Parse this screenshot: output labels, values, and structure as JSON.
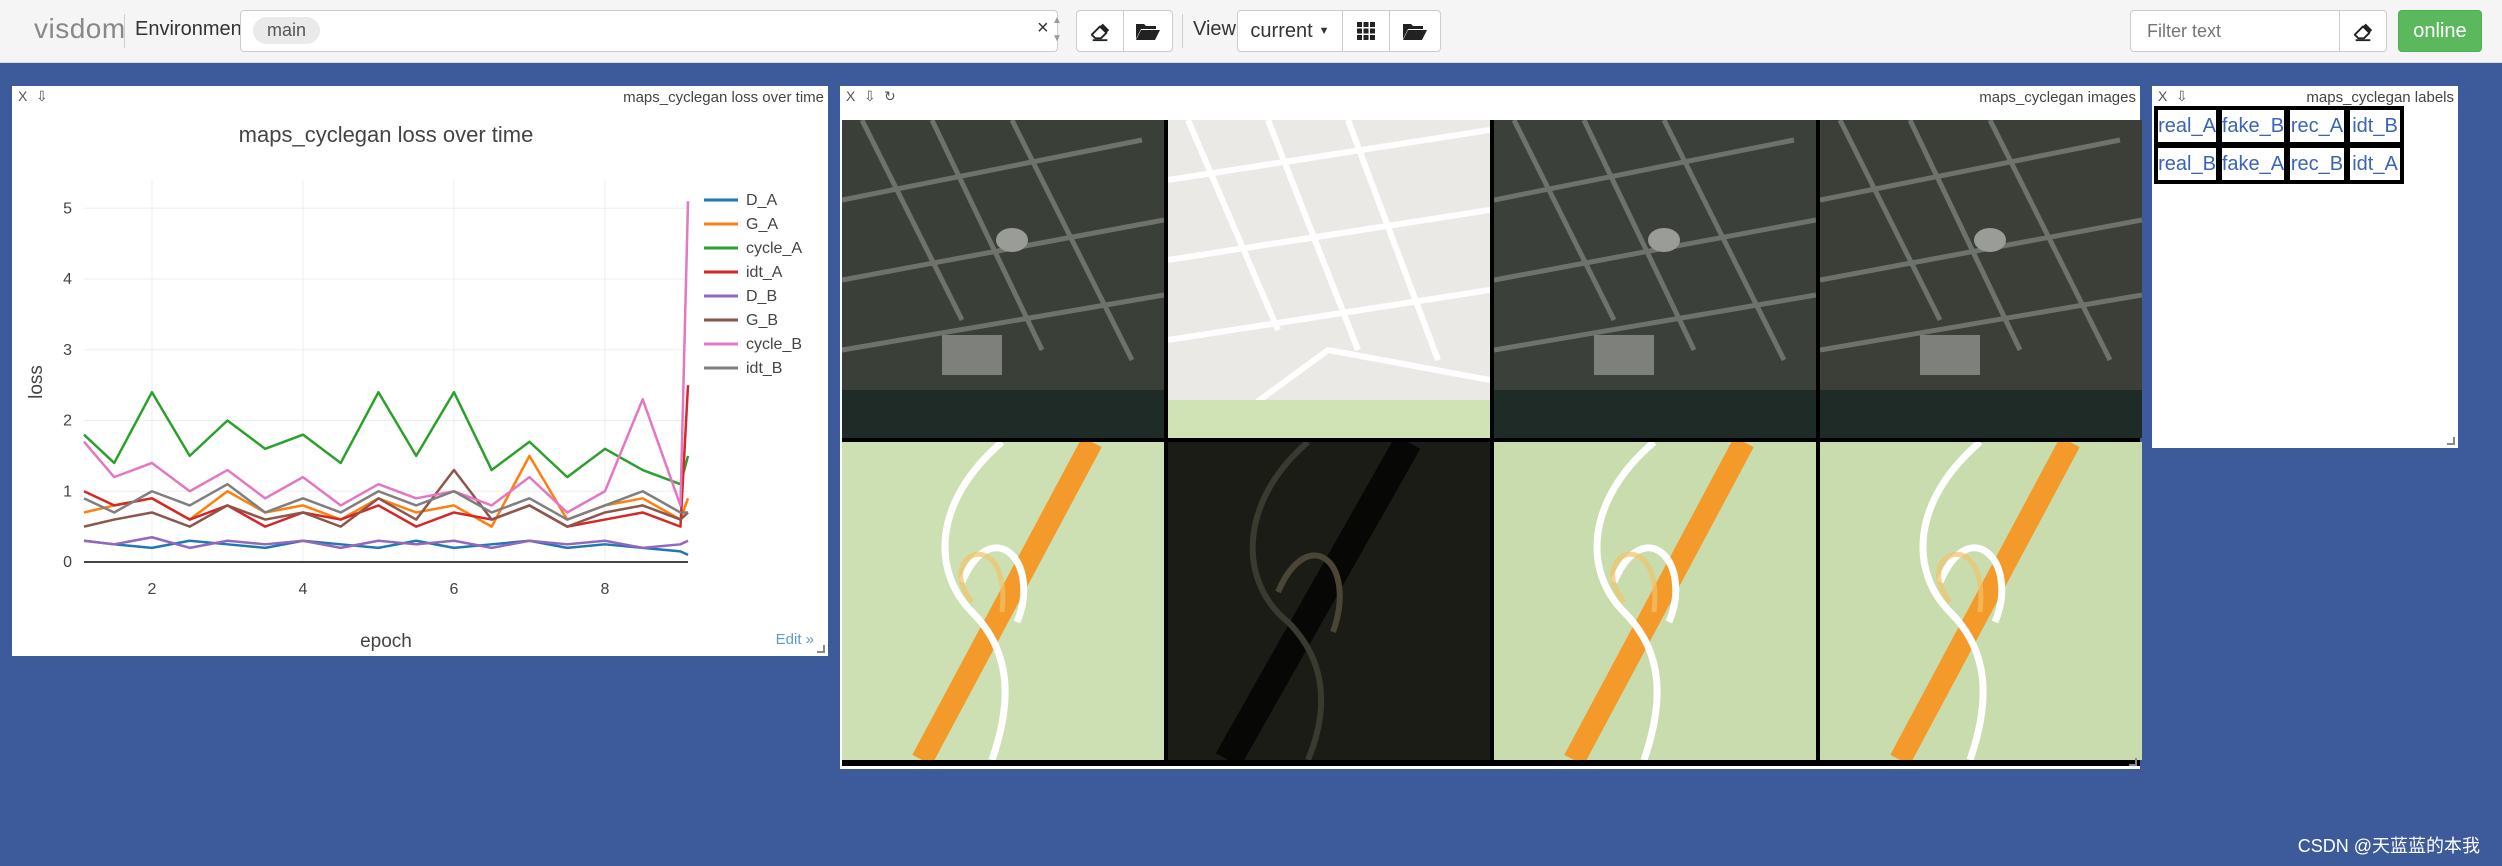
{
  "navbar": {
    "brand": "visdom",
    "environment_label": "Environment",
    "environment_value": "main",
    "environment_clear": "×",
    "view_label": "View",
    "view_value": "current",
    "filter_placeholder": "Filter text",
    "online_label": "online"
  },
  "panes": {
    "loss": {
      "title": "maps_cyclegan loss over time",
      "close": "X",
      "download": "⇩",
      "edit_link": "Edit »"
    },
    "images": {
      "title": "maps_cyclegan images",
      "close": "X",
      "download": "⇩",
      "reset": "↻"
    },
    "labels": {
      "title": "maps_cyclegan labels",
      "close": "X",
      "download": "⇩",
      "rows": [
        [
          "real_A",
          "fake_B",
          "rec_A",
          "idt_B"
        ],
        [
          "real_B",
          "fake_A",
          "rec_B",
          "idt_A"
        ]
      ]
    }
  },
  "chart_data": {
    "type": "line",
    "title": "maps_cyclegan loss over time",
    "xlabel": "epoch",
    "ylabel": "loss",
    "xlim": [
      1.1,
      9.1
    ],
    "ylim": [
      0,
      5.4
    ],
    "xticks": [
      2,
      4,
      6,
      8
    ],
    "yticks": [
      0,
      1,
      2,
      3,
      4,
      5
    ],
    "grid": true,
    "legend_position": "top-right",
    "series": [
      {
        "name": "D_A",
        "color": "#1f77b4",
        "x": [
          1.1,
          1.5,
          2,
          2.5,
          3,
          3.5,
          4,
          4.5,
          5,
          5.5,
          6,
          6.5,
          7,
          7.5,
          8,
          8.5,
          9,
          9.1
        ],
        "y": [
          0.3,
          0.25,
          0.2,
          0.3,
          0.25,
          0.2,
          0.3,
          0.25,
          0.2,
          0.3,
          0.2,
          0.25,
          0.3,
          0.2,
          0.25,
          0.2,
          0.15,
          0.1
        ]
      },
      {
        "name": "G_A",
        "color": "#ff7f0e",
        "x": [
          1.1,
          1.5,
          2,
          2.5,
          3,
          3.5,
          4,
          4.5,
          5,
          5.5,
          6,
          6.5,
          7,
          7.5,
          8,
          8.5,
          9,
          9.1
        ],
        "y": [
          0.7,
          0.8,
          0.9,
          0.6,
          1.0,
          0.7,
          0.8,
          0.6,
          0.9,
          0.7,
          0.8,
          0.5,
          1.5,
          0.6,
          0.8,
          0.9,
          0.6,
          0.9
        ]
      },
      {
        "name": "cycle_A",
        "color": "#2ca02c",
        "x": [
          1.1,
          1.5,
          2,
          2.5,
          3,
          3.5,
          4,
          4.5,
          5,
          5.5,
          6,
          6.5,
          7,
          7.5,
          8,
          8.5,
          9,
          9.1
        ],
        "y": [
          1.8,
          1.4,
          2.4,
          1.5,
          2.0,
          1.6,
          1.8,
          1.4,
          2.4,
          1.5,
          2.4,
          1.3,
          1.7,
          1.2,
          1.6,
          1.3,
          1.1,
          1.5
        ]
      },
      {
        "name": "idt_A",
        "color": "#d62728",
        "x": [
          1.1,
          1.5,
          2,
          2.5,
          3,
          3.5,
          4,
          4.5,
          5,
          5.5,
          6,
          6.5,
          7,
          7.5,
          8,
          8.5,
          9,
          9.1
        ],
        "y": [
          1.0,
          0.8,
          0.9,
          0.6,
          0.8,
          0.5,
          0.7,
          0.6,
          0.8,
          0.5,
          0.7,
          0.6,
          0.8,
          0.5,
          0.6,
          0.7,
          0.5,
          2.5
        ]
      },
      {
        "name": "D_B",
        "color": "#9467bd",
        "x": [
          1.1,
          1.5,
          2,
          2.5,
          3,
          3.5,
          4,
          4.5,
          5,
          5.5,
          6,
          6.5,
          7,
          7.5,
          8,
          8.5,
          9,
          9.1
        ],
        "y": [
          0.3,
          0.25,
          0.35,
          0.2,
          0.3,
          0.25,
          0.3,
          0.2,
          0.3,
          0.25,
          0.3,
          0.2,
          0.3,
          0.25,
          0.3,
          0.2,
          0.25,
          0.3
        ]
      },
      {
        "name": "G_B",
        "color": "#8c564b",
        "x": [
          1.1,
          1.5,
          2,
          2.5,
          3,
          3.5,
          4,
          4.5,
          5,
          5.5,
          6,
          6.5,
          7,
          7.5,
          8,
          8.5,
          9,
          9.1
        ],
        "y": [
          0.5,
          0.6,
          0.7,
          0.5,
          0.8,
          0.6,
          0.7,
          0.5,
          0.9,
          0.6,
          1.3,
          0.6,
          0.8,
          0.5,
          0.7,
          0.8,
          0.6,
          0.7
        ]
      },
      {
        "name": "cycle_B",
        "color": "#e377c2",
        "x": [
          1.1,
          1.5,
          2,
          2.5,
          3,
          3.5,
          4,
          4.5,
          5,
          5.5,
          6,
          6.5,
          7,
          7.5,
          8,
          8.5,
          9,
          9.1
        ],
        "y": [
          1.7,
          1.2,
          1.4,
          1.0,
          1.3,
          0.9,
          1.2,
          0.8,
          1.1,
          0.9,
          1.0,
          0.8,
          1.2,
          0.7,
          1.0,
          2.3,
          0.8,
          5.1
        ]
      },
      {
        "name": "idt_B",
        "color": "#7f7f7f",
        "x": [
          1.1,
          1.5,
          2,
          2.5,
          3,
          3.5,
          4,
          4.5,
          5,
          5.5,
          6,
          6.5,
          7,
          7.5,
          8,
          8.5,
          9,
          9.1
        ],
        "y": [
          0.9,
          0.7,
          1.0,
          0.8,
          1.1,
          0.7,
          0.9,
          0.7,
          1.0,
          0.8,
          1.0,
          0.7,
          0.9,
          0.6,
          0.8,
          1.0,
          0.7,
          0.7
        ]
      }
    ]
  },
  "icons": {
    "eraser": "eraser-icon",
    "folder": "folder-open-icon",
    "grid": "grid-icon"
  },
  "images": [
    {
      "kind": "aerial",
      "tint": "#3a3f37"
    },
    {
      "kind": "map-grid",
      "tint": "#efeeec"
    },
    {
      "kind": "aerial",
      "tint": "#3c403a"
    },
    {
      "kind": "aerial",
      "tint": "#3b3f38"
    },
    {
      "kind": "map-roads",
      "tint": "#cde0b3"
    },
    {
      "kind": "dark-roads",
      "tint": "#1a1c15"
    },
    {
      "kind": "map-roads",
      "tint": "#c9dcad"
    },
    {
      "kind": "map-roads",
      "tint": "#c9dcae"
    }
  ],
  "watermark": "CSDN @天蓝蓝的本我"
}
